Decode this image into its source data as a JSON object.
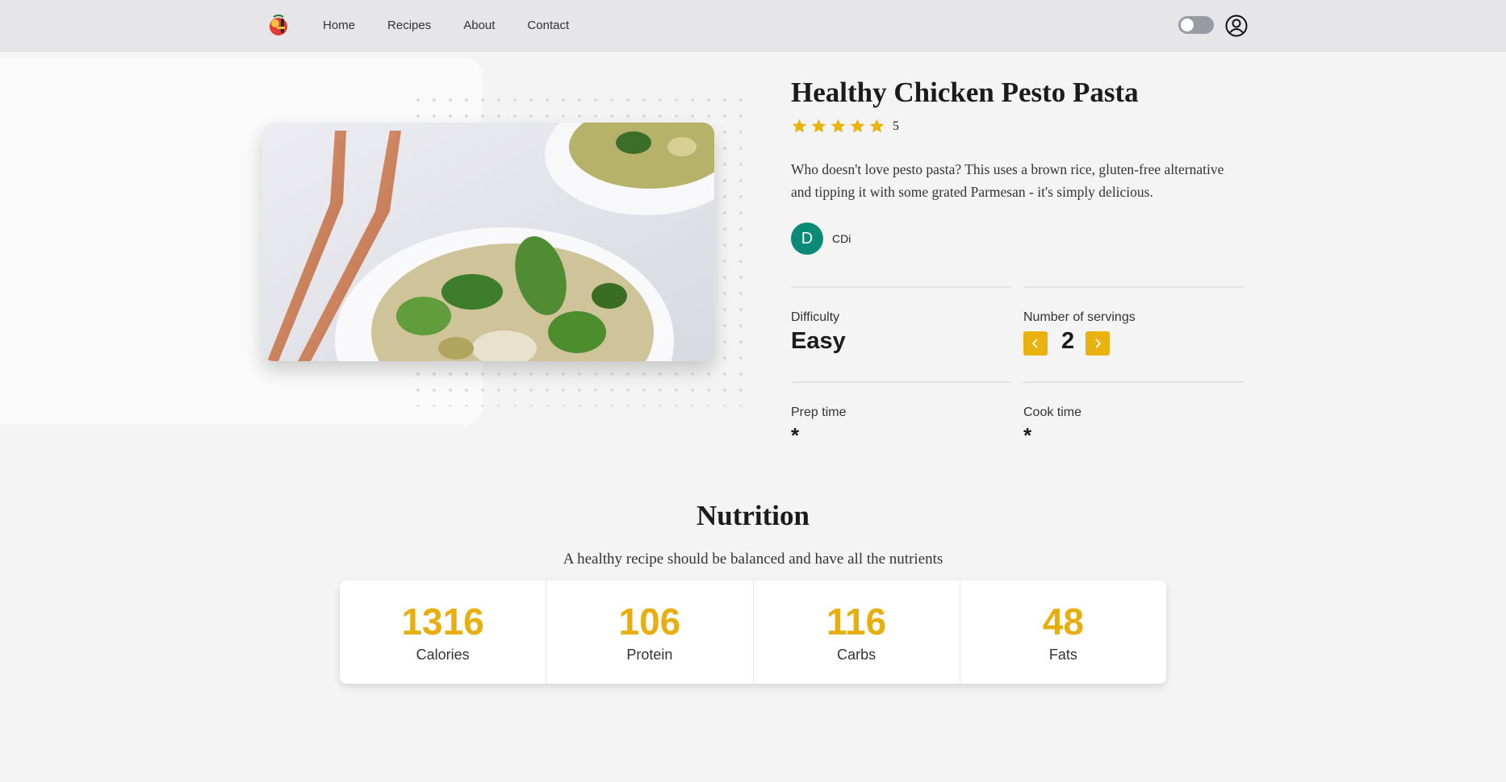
{
  "nav": {
    "items": [
      "Home",
      "Recipes",
      "About",
      "Contact"
    ]
  },
  "recipe": {
    "title": "Healthy Chicken Pesto Pasta",
    "rating_value": "5",
    "stars": 5,
    "description": "Who doesn't love pesto pasta? This uses a brown rice, gluten-free alternative and tipping it with some grated Parmesan - it's simply delicious.",
    "author_initial": "D",
    "author_name": "CDi",
    "difficulty_label": "Difficulty",
    "difficulty_value": "Easy",
    "servings_label": "Number of servings",
    "servings_value": "2",
    "prep_label": "Prep time",
    "prep_value": "*",
    "cook_label": "Cook time",
    "cook_value": "*"
  },
  "nutrition": {
    "title": "Nutrition",
    "subtitle": "A healthy recipe should be balanced and have all the nutrients",
    "items": [
      {
        "value": "1316",
        "label": "Calories"
      },
      {
        "value": "106",
        "label": "Protein"
      },
      {
        "value": "116",
        "label": "Carbs"
      },
      {
        "value": "48",
        "label": "Fats"
      }
    ]
  },
  "colors": {
    "accent": "#e9b20e",
    "avatar": "#0b8a78",
    "header_bg": "#e6e6e8",
    "page_bg": "#f4f4f4"
  },
  "icons": [
    "logo-icon",
    "theme-toggle",
    "user-icon",
    "star-icon",
    "chevron-left-icon",
    "chevron-right-icon"
  ]
}
